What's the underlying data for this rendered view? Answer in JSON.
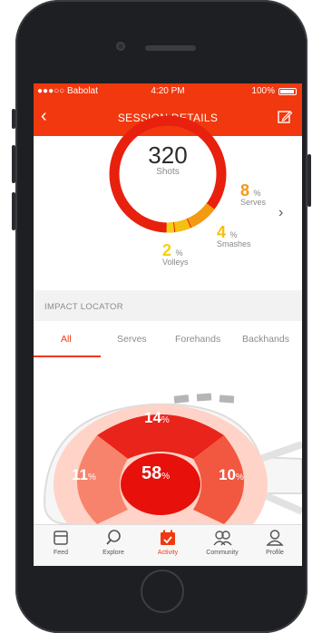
{
  "status_bar": {
    "carrier": "●●●○○ Babolat",
    "time": "4:20 PM",
    "battery": "100%"
  },
  "nav": {
    "back_icon": "chevron-left-icon",
    "title": "SESSION DETAILS",
    "edit_icon": "edit-icon"
  },
  "summary": {
    "shots": "320",
    "shots_label": "Shots",
    "serves": {
      "value": "8",
      "unit": "%",
      "label": "Serves"
    },
    "smashes": {
      "value": "4",
      "unit": "%",
      "label": "Smashes"
    },
    "volleys": {
      "value": "2",
      "unit": "%",
      "label": "Volleys"
    }
  },
  "section_header": "IMPACT LOCATOR",
  "tabs": [
    {
      "label": "All",
      "active": true
    },
    {
      "label": "Serves",
      "active": false
    },
    {
      "label": "Forehands",
      "active": false
    },
    {
      "label": "Backhands",
      "active": false
    }
  ],
  "impact": {
    "top": {
      "value": "14",
      "unit": "%"
    },
    "left": {
      "value": "11",
      "unit": "%"
    },
    "center": {
      "value": "58",
      "unit": "%"
    },
    "right": {
      "value": "10",
      "unit": "%"
    }
  },
  "tabbar": [
    {
      "label": "Feed",
      "icon": "feed-icon",
      "active": false
    },
    {
      "label": "Explore",
      "icon": "search-icon",
      "active": false
    },
    {
      "label": "Activity",
      "icon": "calendar-icon",
      "active": true
    },
    {
      "label": "Community",
      "icon": "community-icon",
      "active": false
    },
    {
      "label": "Profile",
      "icon": "profile-icon",
      "active": false
    }
  ],
  "colors": {
    "brand": "#f1380e",
    "ring_red": "#e8200e",
    "ring_yellow": "#f5c010",
    "ring_orange": "#f49a10",
    "serves": "#f49a10",
    "smashes": "#f5c010",
    "volleys": "#f5d010"
  }
}
